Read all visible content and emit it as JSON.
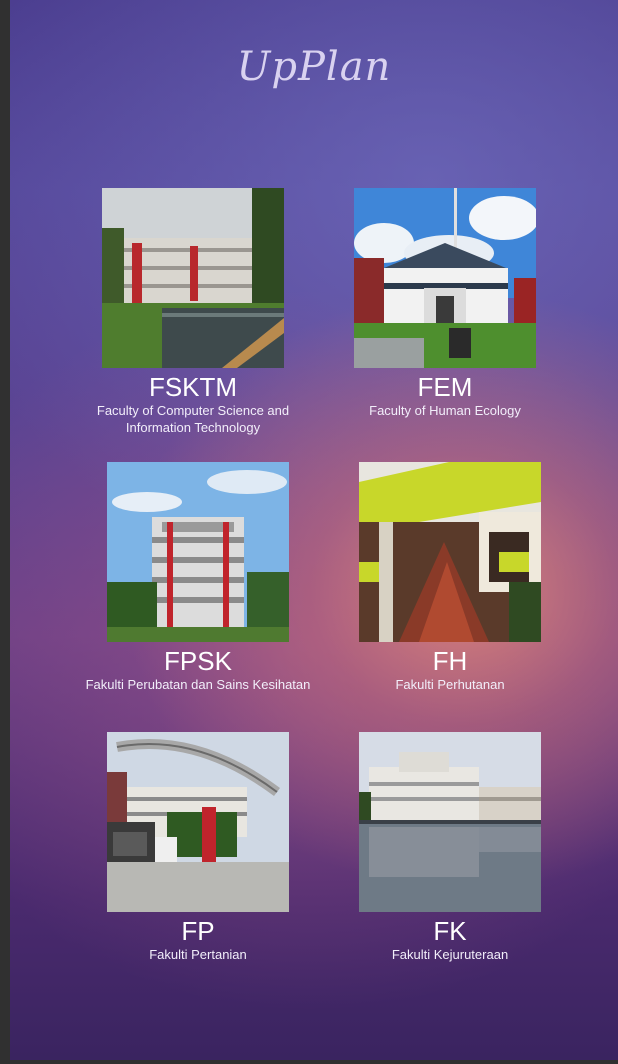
{
  "app": {
    "title": "UpPlan"
  },
  "faculties": [
    {
      "code": "FSKTM",
      "name": "Faculty of Computer Science and Information Technology",
      "icon": "fsktm-building-photo"
    },
    {
      "code": "FEM",
      "name": "Faculty of Human Ecology",
      "icon": "fem-building-photo"
    },
    {
      "code": "FPSK",
      "name": "Fakulti Perubatan dan Sains Kesihatan",
      "icon": "fpsk-building-photo"
    },
    {
      "code": "FH",
      "name": "Fakulti Perhutanan",
      "icon": "fh-building-photo"
    },
    {
      "code": "FP",
      "name": "Fakulti Pertanian",
      "icon": "fp-building-photo"
    },
    {
      "code": "FK",
      "name": "Fakulti Kejuruteraan",
      "icon": "fk-building-photo"
    }
  ]
}
